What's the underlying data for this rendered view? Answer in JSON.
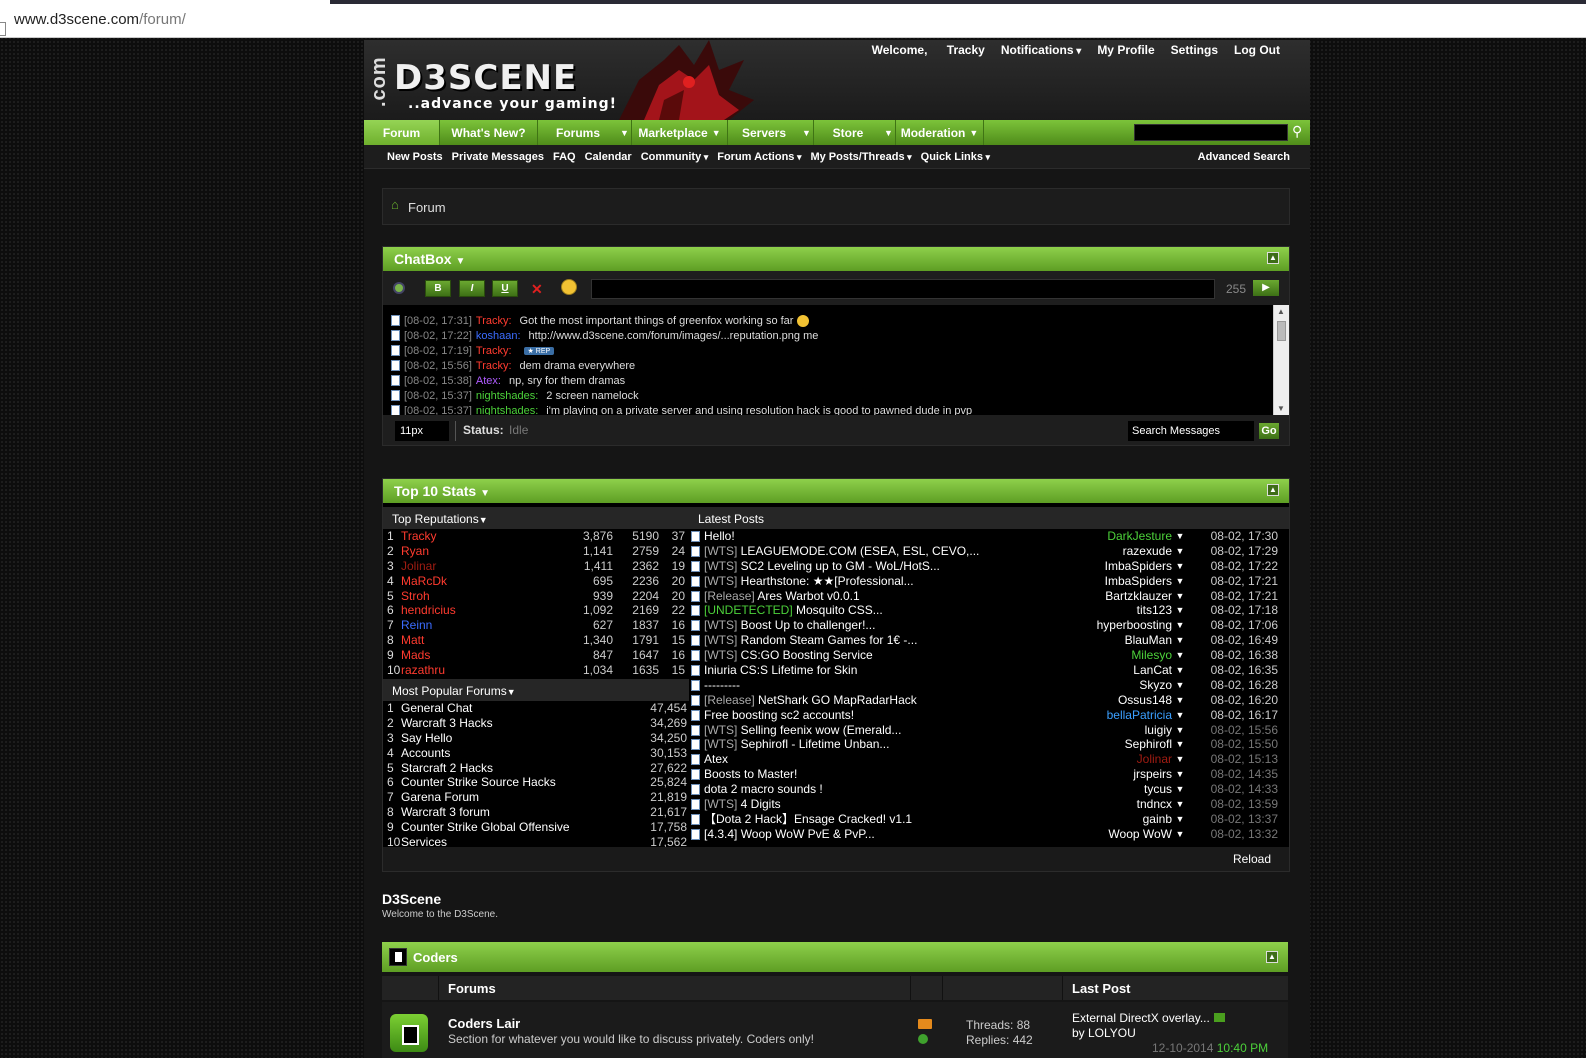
{
  "browser": {
    "url_domain": "www.d3scene.com",
    "url_path": "/forum/"
  },
  "header": {
    "logo_com": ".com",
    "logo": "D3SCENE",
    "tagline": "..advance your gaming!",
    "welcome": "Welcome,",
    "user": "Tracky",
    "notifications": "Notifications",
    "profile": "My Profile",
    "settings": "Settings",
    "logout": "Log Out"
  },
  "nav": {
    "tabs": [
      "Forum",
      "What's New?",
      "Forums",
      "Marketplace",
      "Servers",
      "Store",
      "Moderation"
    ]
  },
  "subnav": {
    "items": [
      "New Posts",
      "Private Messages",
      "FAQ",
      "Calendar",
      "Community",
      "Forum Actions",
      "My Posts/Threads",
      "Quick Links"
    ],
    "advanced": "Advanced Search"
  },
  "breadcrumb": "Forum",
  "chatbox": {
    "title": "ChatBox",
    "count": "255",
    "font_size": "11px",
    "status_label": "Status:",
    "status_value": "Idle",
    "search": "Search Messages",
    "go": "Go",
    "messages": [
      {
        "time": "[08-02, 17:31]",
        "user": "Tracky:",
        "color": "#ff3b2f",
        "text": "Got the most important things of greenfox working so far"
      },
      {
        "time": "[08-02, 17:22]",
        "user": "koshaan:",
        "color": "#3b6cff",
        "text": "http://www.d3scene.com/forum/images/...reputation.png me"
      },
      {
        "time": "[08-02, 17:19]",
        "user": "Tracky:",
        "color": "#ff3b2f",
        "text": ""
      },
      {
        "time": "[08-02, 15:56]",
        "user": "Tracky:",
        "color": "#ff3b2f",
        "text": "dem drama everywhere"
      },
      {
        "time": "[08-02, 15:38]",
        "user": "Atex:",
        "color": "#b05cff",
        "text": "np, sry for them dramas"
      },
      {
        "time": "[08-02, 15:37]",
        "user": "nightshades:",
        "color": "#4cd13a",
        "text": "2 screen namelock"
      },
      {
        "time": "[08-02, 15:37]",
        "user": "nightshades:",
        "color": "#4cd13a",
        "text": "i'm playing on a private server and using resolution hack is good to pawned dude in pvp"
      }
    ]
  },
  "top10": {
    "title": "Top 10 Stats",
    "rep_header": "Top Reputations",
    "latest_header": "Latest Posts",
    "popular_header": "Most Popular Forums",
    "reload": "Reload",
    "reputations": [
      {
        "n": "1",
        "name": "Tracky",
        "color": "#ff3b2f",
        "a": "3,876",
        "b": "5190",
        "c": "37"
      },
      {
        "n": "2",
        "name": "Ryan",
        "color": "#ff3b2f",
        "a": "1,141",
        "b": "2759",
        "c": "24"
      },
      {
        "n": "3",
        "name": "Jolinar",
        "color": "#a01c12",
        "a": "1,411",
        "b": "2362",
        "c": "19"
      },
      {
        "n": "4",
        "name": "MaRcDk",
        "color": "#ff3b2f",
        "a": "695",
        "b": "2236",
        "c": "20"
      },
      {
        "n": "5",
        "name": "Stroh",
        "color": "#ff3b2f",
        "a": "939",
        "b": "2204",
        "c": "20"
      },
      {
        "n": "6",
        "name": "hendricius",
        "color": "#ff3b2f",
        "a": "1,092",
        "b": "2169",
        "c": "22"
      },
      {
        "n": "7",
        "name": "Reinn",
        "color": "#3b6cff",
        "a": "627",
        "b": "1837",
        "c": "16"
      },
      {
        "n": "8",
        "name": "Matt",
        "color": "#ff3b2f",
        "a": "1,340",
        "b": "1791",
        "c": "15"
      },
      {
        "n": "9",
        "name": "Mads",
        "color": "#ff3b2f",
        "a": "847",
        "b": "1647",
        "c": "16"
      },
      {
        "n": "10",
        "name": "razathru",
        "color": "#ff3b2f",
        "a": "1,034",
        "b": "1635",
        "c": "15"
      }
    ],
    "popular": [
      {
        "n": "1",
        "name": "General Chat",
        "c": "47,454"
      },
      {
        "n": "2",
        "name": "Warcraft 3 Hacks",
        "c": "34,269"
      },
      {
        "n": "3",
        "name": "Say Hello",
        "c": "34,250"
      },
      {
        "n": "4",
        "name": "Accounts",
        "c": "30,153"
      },
      {
        "n": "5",
        "name": "Starcraft 2 Hacks",
        "c": "27,622"
      },
      {
        "n": "6",
        "name": "Counter Strike Source Hacks",
        "c": "25,824"
      },
      {
        "n": "7",
        "name": "Garena Forum",
        "c": "21,819"
      },
      {
        "n": "8",
        "name": "Warcraft 3 forum",
        "c": "21,617"
      },
      {
        "n": "9",
        "name": "Counter Strike Global Offensive",
        "c": "17,758"
      },
      {
        "n": "10",
        "name": "Services",
        "c": "17,562"
      }
    ],
    "latest": [
      {
        "pre": "",
        "title": "Hello!",
        "user": "DarkJesture",
        "ucolor": "#4cd13a",
        "date": "08-02, 17:30"
      },
      {
        "pre": "[WTS]",
        "title": "LEAGUEMODE.COM (ESEA, ESL, CEVO,...",
        "user": "razexude",
        "ucolor": "#fff",
        "date": "08-02, 17:29"
      },
      {
        "pre": "[WTS]",
        "title": "SC2 Leveling up to GM - WoL/HotS...",
        "user": "ImbaSpiders",
        "ucolor": "#fff",
        "date": "08-02, 17:22"
      },
      {
        "pre": "[WTS]",
        "title": "Hearthstone: ★★[Professional...",
        "user": "ImbaSpiders",
        "ucolor": "#fff",
        "date": "08-02, 17:21"
      },
      {
        "pre": "[Release]",
        "title": "Ares Warbot v0.0.1",
        "user": "Bartzklauzer",
        "ucolor": "#fff",
        "date": "08-02, 17:21"
      },
      {
        "pre": "[UNDETECTED]",
        "title": "Mosquito CSS...",
        "user": "tits123",
        "ucolor": "#fff",
        "date": "08-02, 17:18",
        "green": true
      },
      {
        "pre": "[WTS]",
        "title": "Boost Up to challenger!...",
        "user": "hyperboosting",
        "ucolor": "#fff",
        "date": "08-02, 17:06"
      },
      {
        "pre": "[WTS]",
        "title": "Random Steam Games for 1€ -...",
        "user": "BlauMan",
        "ucolor": "#fff",
        "date": "08-02, 16:49"
      },
      {
        "pre": "[WTS]",
        "title": "CS:GO Boosting Service",
        "user": "Milesyo",
        "ucolor": "#4cd13a",
        "date": "08-02, 16:38"
      },
      {
        "pre": "",
        "title": "Iniuria CS:S Lifetime for Skin",
        "user": "LanCat",
        "ucolor": "#fff",
        "date": "08-02, 16:35"
      },
      {
        "pre": "",
        "title": "---------",
        "user": "Skyzo",
        "ucolor": "#fff",
        "date": "08-02, 16:28"
      },
      {
        "pre": "[Release]",
        "title": "NetShark GO MapRadarHack",
        "user": "Ossus148",
        "ucolor": "#fff",
        "date": "08-02, 16:20"
      },
      {
        "pre": "",
        "title": "Free boosting sc2 accounts!",
        "user": "bellaPatricia",
        "ucolor": "#3ba0ff",
        "date": "08-02, 16:17"
      },
      {
        "pre": "[WTS]",
        "title": "Selling feenix wow (Emerald...",
        "user": "luigiy",
        "ucolor": "#fff",
        "date": "08-02, 15:56"
      },
      {
        "pre": "[WTS]",
        "title": "Sephirofl - Lifetime Unban...",
        "user": "Sephirofl",
        "ucolor": "#fff",
        "date": "08-02, 15:50"
      },
      {
        "pre": "",
        "title": "Atex",
        "user": "Jolinar",
        "ucolor": "#a01c12",
        "date": "08-02, 15:13"
      },
      {
        "pre": "",
        "title": "Boosts to Master!",
        "user": "jrspeirs",
        "ucolor": "#fff",
        "date": "08-02, 14:35"
      },
      {
        "pre": "",
        "title": "dota 2 macro sounds !",
        "user": "tycus",
        "ucolor": "#fff",
        "date": "08-02, 14:33"
      },
      {
        "pre": "[WTS]",
        "title": "4 Digits",
        "user": "tndncx",
        "ucolor": "#fff",
        "date": "08-02, 13:59"
      },
      {
        "pre": "",
        "title": "【Dota 2 Hack】Ensage Cracked! v1.1",
        "user": "gainb",
        "ucolor": "#fff",
        "date": "08-02, 13:37"
      },
      {
        "pre": "",
        "title": "[4.3.4] Woop WoW PvE & PvP...",
        "user": "Woop WoW",
        "ucolor": "#fff",
        "date": "08-02, 13:32"
      }
    ]
  },
  "site": {
    "name": "D3Scene",
    "welcome": "Welcome to the D3Scene."
  },
  "coders": {
    "title": "Coders",
    "col_forums": "Forums",
    "col_last": "Last Post",
    "forum": {
      "name": "Coders Lair",
      "desc": "Section for whatever you would like to discuss privately. Coders only!",
      "threads": "Threads: 88",
      "replies": "Replies: 442",
      "last_title": "External DirectX overlay...",
      "last_by": "by LOLYOU",
      "last_date": "12-10-2014",
      "last_time": "10:40 PM"
    }
  }
}
